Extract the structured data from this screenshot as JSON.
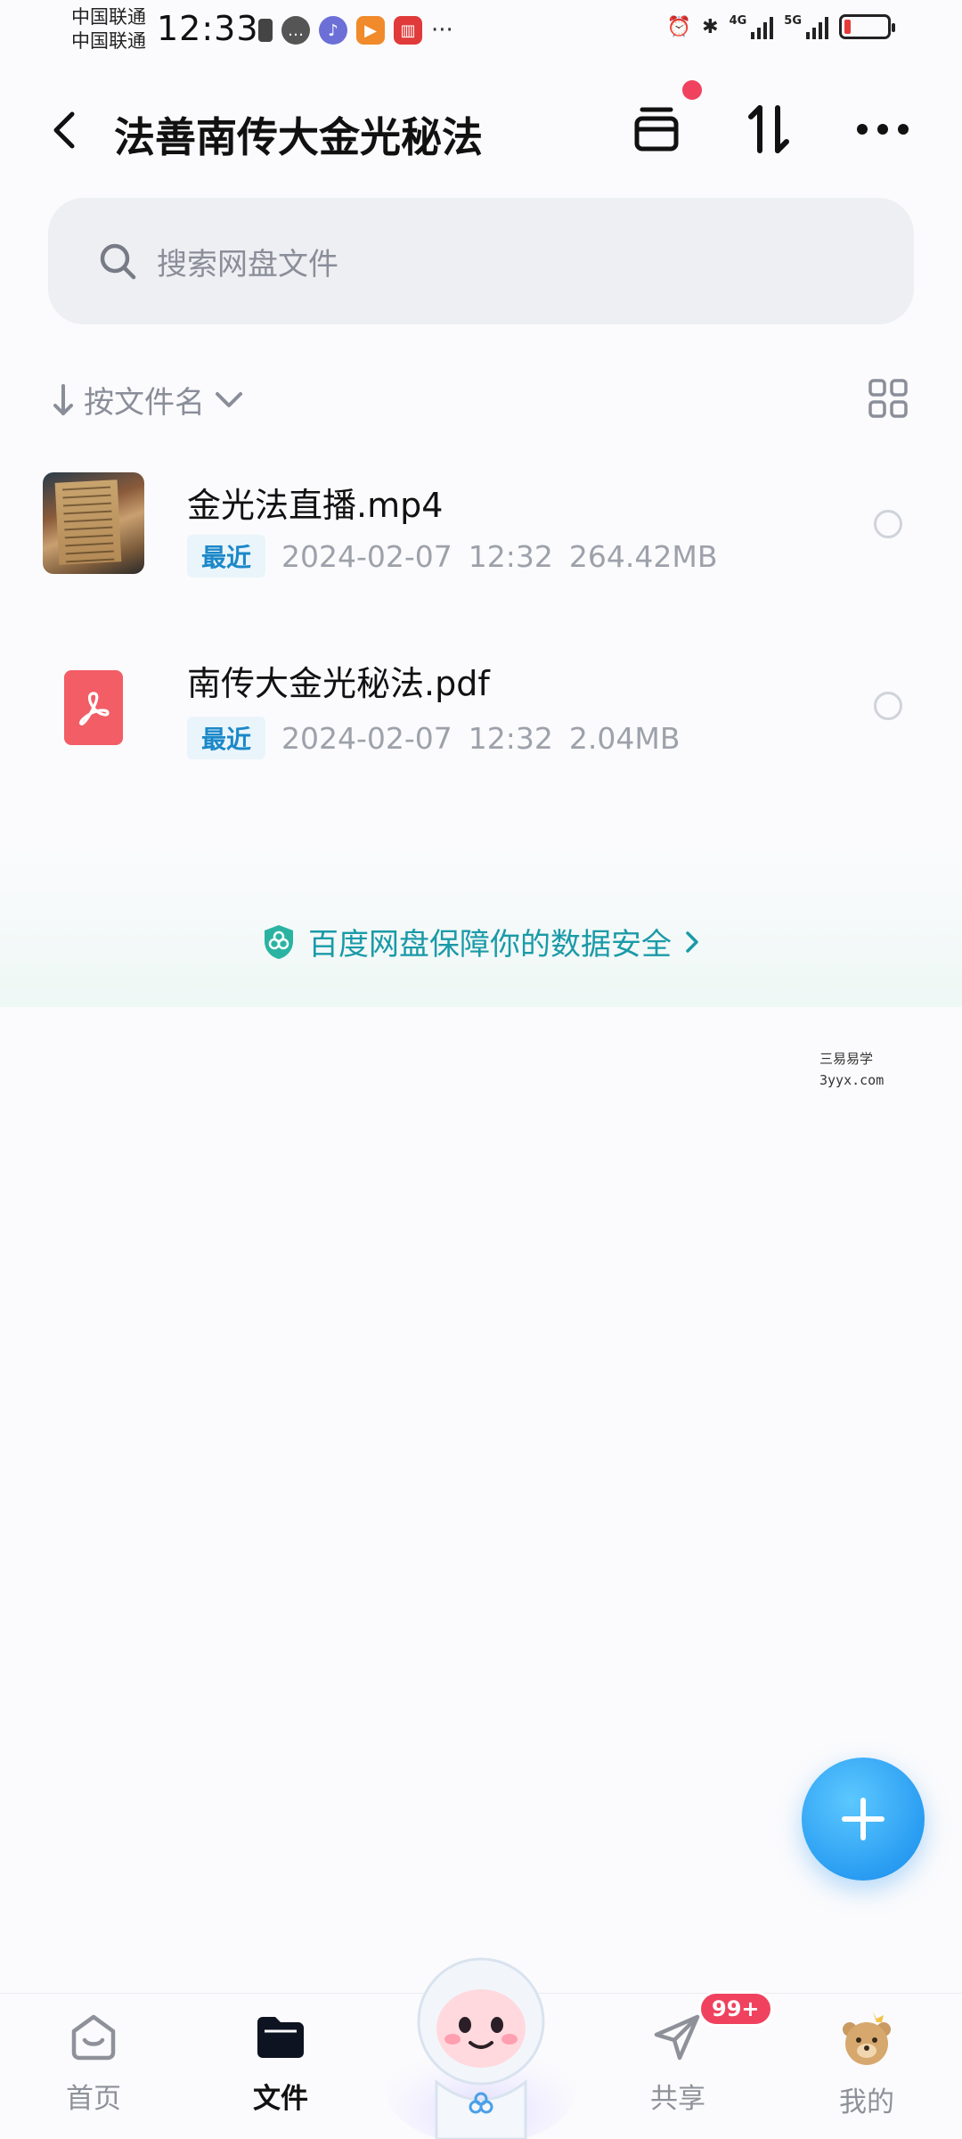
{
  "status_bar": {
    "carrier_1": "中国联通",
    "carrier_2": "中国联通",
    "time": "12:33",
    "net_1": "4G",
    "net_2": "5G",
    "battery_color": "#e63b3b"
  },
  "header": {
    "title": "法善南传大金光秘法",
    "back_icon": "chevron-left-icon",
    "archive_icon": "archive-box-icon",
    "transfer_icon": "transfer-arrows-icon",
    "more_icon": "more-dots-icon",
    "notification_dot_color": "#f0425f"
  },
  "search": {
    "placeholder": "搜索网盘文件",
    "icon": "search-icon"
  },
  "sort": {
    "label": "按文件名",
    "view_toggle_icon": "grid-view-icon"
  },
  "files": [
    {
      "name": "金光法直播.mp4",
      "badge": "最近",
      "date": "2024-02-07",
      "time": "12:32",
      "size": "264.42MB",
      "type": "video"
    },
    {
      "name": "南传大金光秘法.pdf",
      "badge": "最近",
      "date": "2024-02-07",
      "time": "12:32",
      "size": "2.04MB",
      "type": "pdf"
    }
  ],
  "security_banner": {
    "text": "百度网盘保障你的数据安全",
    "icon": "shield-icon"
  },
  "watermark": {
    "line1": "三易易学",
    "line2": "3yyx.com"
  },
  "fab": {
    "icon": "plus-icon",
    "color": "#2a9df2"
  },
  "bottom_nav": {
    "items": [
      {
        "label": "首页",
        "icon": "home-icon",
        "active": false
      },
      {
        "label": "文件",
        "icon": "folder-icon",
        "active": true
      },
      {
        "label": "",
        "icon": "mascot-icon",
        "active": false
      },
      {
        "label": "共享",
        "icon": "send-icon",
        "active": false,
        "badge": "99+"
      },
      {
        "label": "我的",
        "icon": "profile-bear-icon",
        "active": false
      }
    ]
  }
}
